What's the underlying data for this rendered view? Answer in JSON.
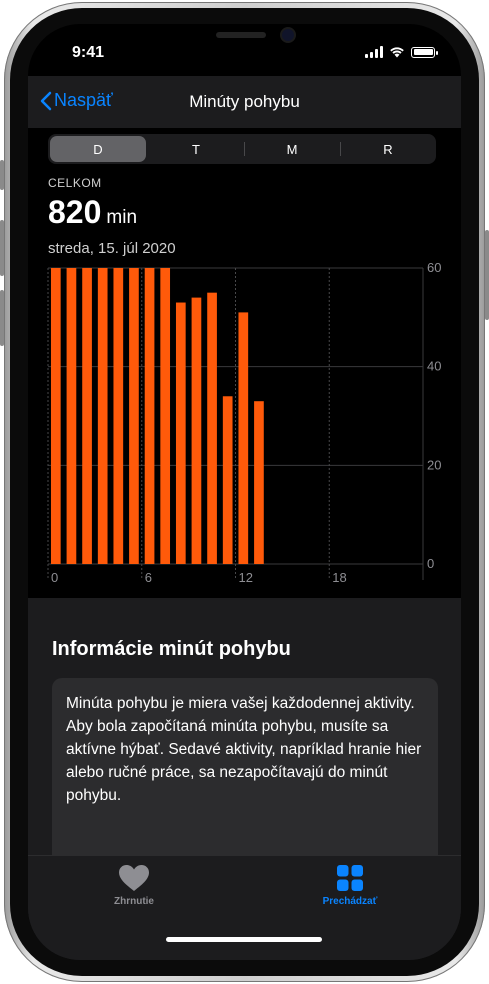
{
  "status": {
    "time": "9:41"
  },
  "nav": {
    "back_label": "Naspäť",
    "title": "Minúty pohybu"
  },
  "segments": [
    "D",
    "T",
    "M",
    "R"
  ],
  "selected_segment": "D",
  "summary": {
    "total_label": "CELKOM",
    "total_value": "820",
    "unit": "min",
    "date": "streda, 15. júl 2020"
  },
  "chart_data": {
    "type": "bar",
    "x_ticks": [
      "0",
      "6",
      "12",
      "18"
    ],
    "y_ticks": [
      "60",
      "40",
      "20",
      "0"
    ],
    "ylim": [
      0,
      60
    ],
    "values": [
      60,
      60,
      60,
      60,
      60,
      60,
      60,
      60,
      53,
      54,
      55,
      34,
      51,
      33
    ],
    "bar_color": "#ff5a0a",
    "grid": true
  },
  "info": {
    "heading": "Informácie minút pohybu",
    "body": "Minúta pohybu je miera vašej každodennej aktivity. Aby bola započítaná minúta pohybu, musíte sa aktívne hýbať. Sedavé aktivity, napríklad hranie hier alebo ručné práce, sa nezapočítavajú do minút pohybu."
  },
  "tabs": [
    {
      "label": "Zhrnutie",
      "icon": "heart-icon",
      "selected": false
    },
    {
      "label": "Prechádzať",
      "icon": "grid-icon",
      "selected": true
    }
  ],
  "colors": {
    "accent": "#0a84ff",
    "bar": "#ff5a0a"
  }
}
